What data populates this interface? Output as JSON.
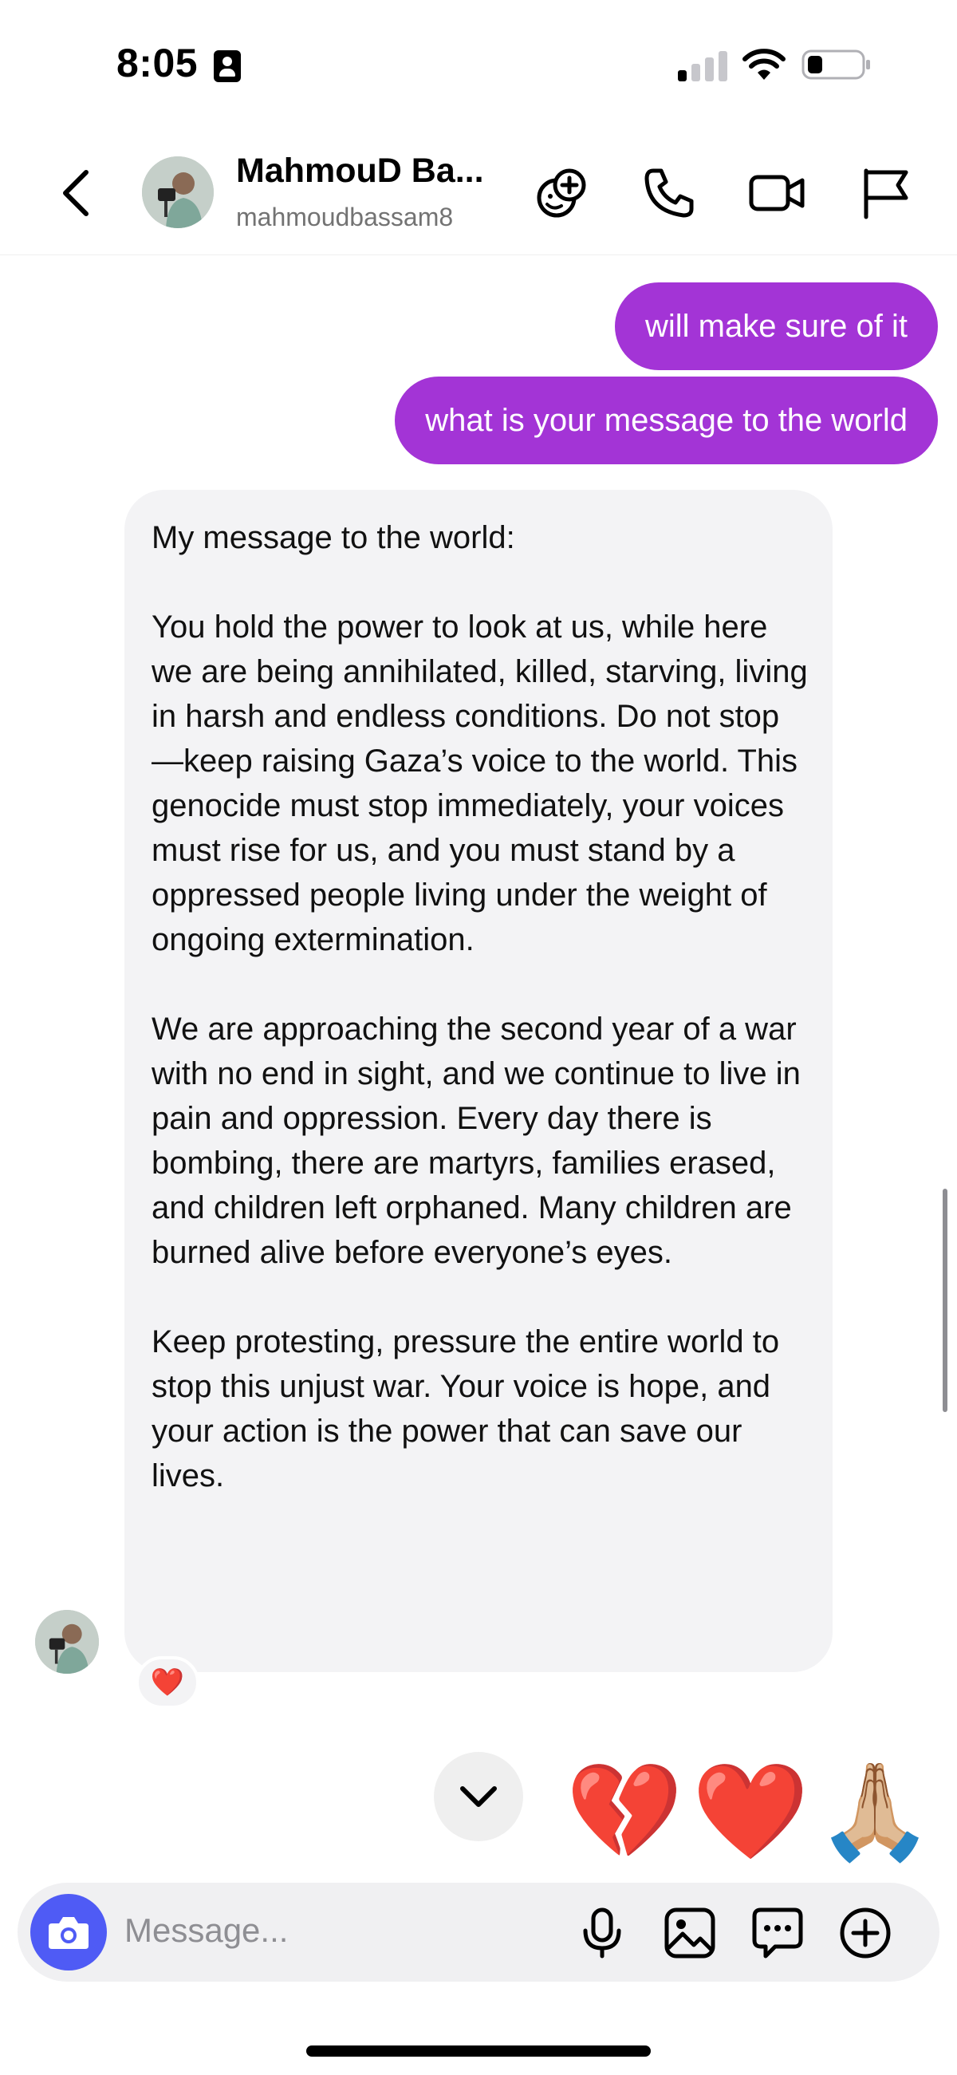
{
  "status_bar": {
    "time": "8:05"
  },
  "header": {
    "contact_name": "MahmouD Ba...",
    "contact_handle": "mahmoudbassam8"
  },
  "messages": {
    "outgoing": [
      "will make sure of it",
      "what is your message to the world"
    ],
    "incoming": {
      "paragraphs": [
        "My message to the world:",
        "You hold the power to look at us, while here we are being annihilated, killed, starving, living in harsh and endless conditions. Do not stop—keep raising Gaza’s voice to the world. This genocide must stop immediately, your voices must rise for us, and you must stand by a oppressed people living under the weight of ongoing extermination.",
        "We are approaching the second year of a war with no end in sight, and we continue to live in pain and oppression. Every day there is bombing, there are martyrs, families erased, and children left orphaned. Many children are burned alive before everyone’s eyes.",
        "Keep protesting, pressure the entire world to stop this unjust war. Your voice is hope, and your action is the power that can save our lives."
      ],
      "reaction": "❤️"
    }
  },
  "quick_reactions": [
    "💔",
    "❤️",
    "🙏🏼"
  ],
  "composer": {
    "placeholder": "Message..."
  },
  "colors": {
    "outgoing_bubble": "#a334d6",
    "incoming_bubble": "#f3f3f5",
    "camera_button": "#4f5bf5"
  },
  "icons": [
    "back-chevron-icon",
    "add-effects-icon",
    "phone-icon",
    "video-camera-icon",
    "flag-icon",
    "chevron-down-icon",
    "camera-icon",
    "microphone-icon",
    "image-icon",
    "sticker-icon",
    "plus-circle-icon"
  ]
}
